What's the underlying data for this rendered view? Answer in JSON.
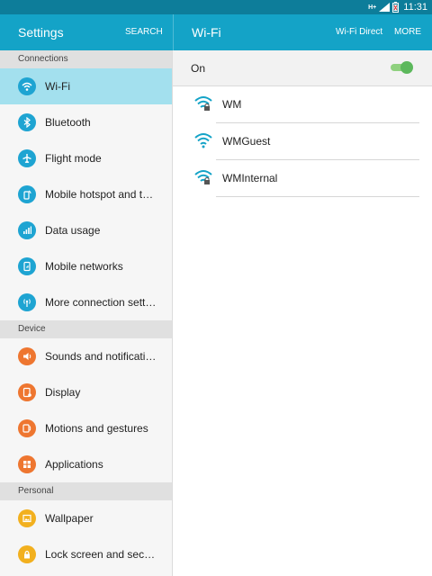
{
  "status_bar": {
    "time": "11:31",
    "network_label": "H+"
  },
  "header": {
    "settings_title": "Settings",
    "search_label": "SEARCH",
    "wifi_title": "Wi-Fi",
    "wifi_direct_label": "Wi-Fi Direct",
    "more_label": "MORE"
  },
  "sidebar": {
    "sections": {
      "connections": "Connections",
      "device": "Device",
      "personal": "Personal"
    },
    "items": [
      {
        "label": "Wi-Fi",
        "icon": "wifi-icon",
        "color": "#1ea4d2"
      },
      {
        "label": "Bluetooth",
        "icon": "bluetooth-icon",
        "color": "#1ea4d2"
      },
      {
        "label": "Flight mode",
        "icon": "airplane-icon",
        "color": "#1ea4d2"
      },
      {
        "label": "Mobile hotspot and tet..",
        "icon": "hotspot-icon",
        "color": "#1ea4d2"
      },
      {
        "label": "Data usage",
        "icon": "data-usage-icon",
        "color": "#1ea4d2"
      },
      {
        "label": "Mobile networks",
        "icon": "mobile-network-icon",
        "color": "#1ea4d2"
      },
      {
        "label": "More connection settin..",
        "icon": "antenna-icon",
        "color": "#1ea4d2"
      },
      {
        "label": "Sounds and notification..",
        "icon": "speaker-icon",
        "color": "#ee7630"
      },
      {
        "label": "Display",
        "icon": "display-icon",
        "color": "#ee7630"
      },
      {
        "label": "Motions and gestures",
        "icon": "gesture-icon",
        "color": "#ee7630"
      },
      {
        "label": "Applications",
        "icon": "apps-grid-icon",
        "color": "#ee7630"
      },
      {
        "label": "Wallpaper",
        "icon": "wallpaper-icon",
        "color": "#f2b01e"
      },
      {
        "label": "Lock screen and securi..",
        "icon": "lock-icon",
        "color": "#f2b01e"
      }
    ]
  },
  "wifi": {
    "toggle_label": "On",
    "enabled": true,
    "accent": "#5cb85c",
    "networks": [
      {
        "name": "WM",
        "secured": true
      },
      {
        "name": "WMGuest",
        "secured": false
      },
      {
        "name": "WMInternal",
        "secured": true
      }
    ]
  }
}
